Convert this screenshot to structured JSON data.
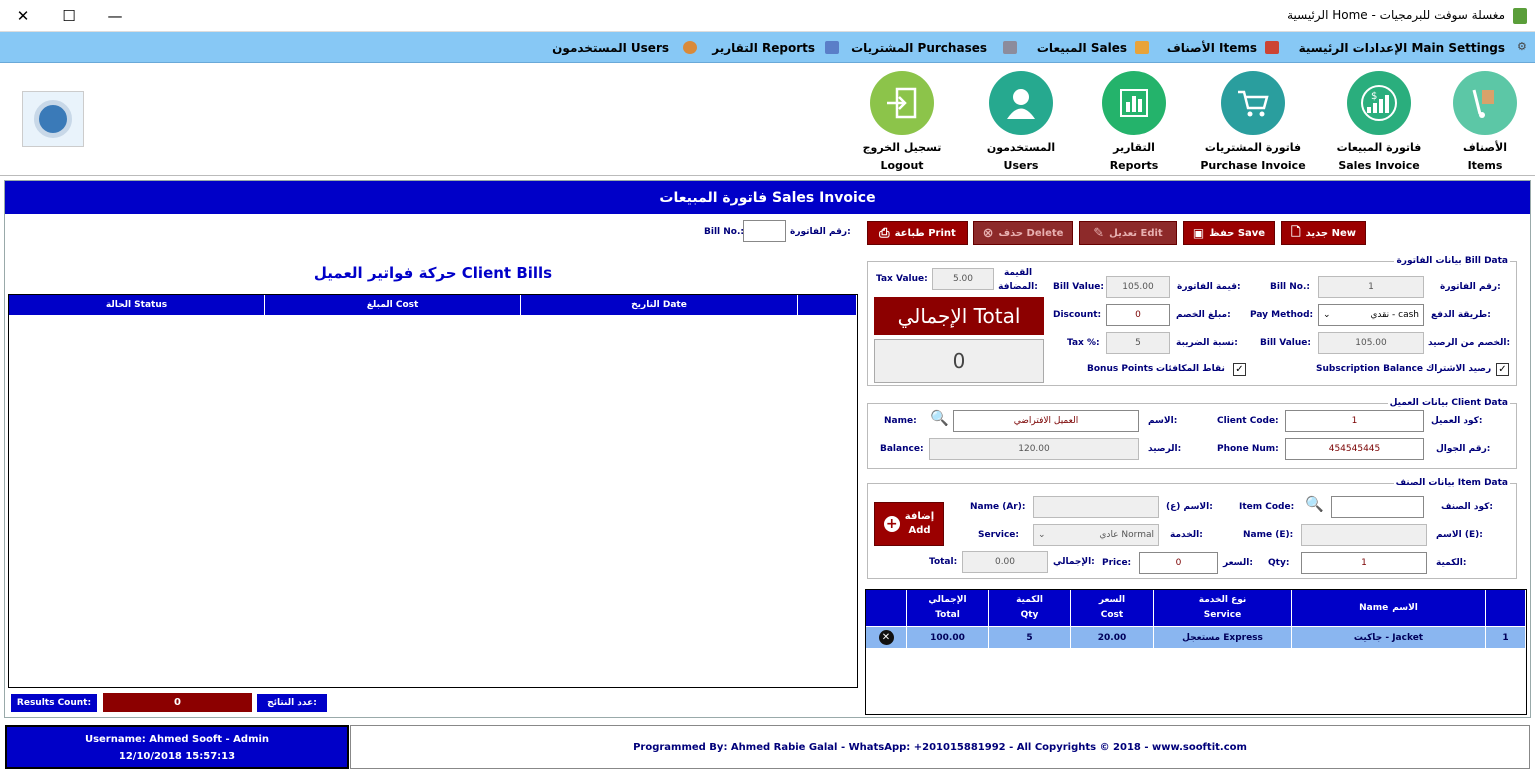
{
  "window": {
    "title": "الرئيسية Home - مغسلة سوفت للبرمجيات"
  },
  "menu": [
    {
      "label": "الإعدادات الرئيسية Main Settings",
      "icon": "gears-icon"
    },
    {
      "label": "الأصناف Items",
      "icon": "cart-icon"
    },
    {
      "label": "المبيعات Sales",
      "icon": "box-icon"
    },
    {
      "label": "المشتريات Purchases",
      "icon": "pen-icon"
    },
    {
      "label": "التقارير Reports",
      "icon": "books-icon"
    },
    {
      "label": "المستخدمون Users",
      "icon": "users-icon"
    }
  ],
  "toolbar": [
    {
      "ar": "الأصناف",
      "en": "Items",
      "icon": "hand-truck-icon",
      "color": "#5cc7a6"
    },
    {
      "ar": "فاتورة المبيعات",
      "en": "Sales Invoice",
      "icon": "growth-chart-icon",
      "color": "#2aae7d"
    },
    {
      "ar": "فاتورة المشتريات",
      "en": "Purchase Invoice",
      "icon": "shopping-cart-icon",
      "color": "#2a9e9e"
    },
    {
      "ar": "التقارير",
      "en": "Reports",
      "icon": "bar-chart-icon",
      "color": "#24b36b"
    },
    {
      "ar": "المستخدمون",
      "en": "Users",
      "icon": "user-icon",
      "color": "#26a98f"
    },
    {
      "ar": "تسجيل الخروج",
      "en": "Logout",
      "icon": "logout-icon",
      "color": "#8cc44a"
    }
  ],
  "header": {
    "title": "فاتورة المبيعات Sales Invoice"
  },
  "bill_search": {
    "label_ar": "رقم الفاتورة:",
    "label_en": "Bill No.:",
    "value": ""
  },
  "buttons": {
    "new": "جديد New",
    "save": "حفظ Save",
    "edit": "تعديل Edit",
    "delete": "حذف Delete",
    "print": "طباعة Print"
  },
  "bill_data": {
    "title": "بيانات الفاتورة Bill Data",
    "bill_no_ar": "رقم الفاتورة:",
    "bill_no_en": "Bill No.:",
    "bill_no": "1",
    "bill_value_ar": "قيمة الفاتورة:",
    "bill_value_en": "Bill Value:",
    "bill_value": "105.00",
    "tax_value_ar": "القيمة المضافة:",
    "tax_value_en": "Tax Value:",
    "tax_value": "5.00",
    "pay_method_ar": "طريقة الدفع:",
    "pay_method_en": "Pay Method:",
    "pay_method": "نقدي - cash",
    "discount_ar": "مبلغ الخصم:",
    "discount_en": "Discount:",
    "discount": "0",
    "deduct_ar": "الخصم من الرصيد:",
    "deduct_en": "Bill Value:",
    "deduct_value": "105.00",
    "tax_pct_ar": "نسبة الضريبة:",
    "tax_pct_en": "Tax %:",
    "tax_pct": "5",
    "subscription_ar": "رصيد الاشتراك",
    "subscription_en": "Subscription Balance",
    "bonus_ar": "نقاط المكافئات",
    "bonus_en": "Bonus Points",
    "total_label": "الإجمالي Total",
    "total_value": "0"
  },
  "client_data": {
    "title": "بيانات العميل Client Data",
    "code_ar": "كود العميل:",
    "code_en": "Client Code:",
    "code": "1",
    "name_ar": "الاسم:",
    "name_en": "Name:",
    "name": "العميل الافتراضي",
    "phone_ar": "رقم الجوال:",
    "phone_en": "Phone Num:",
    "phone": "454545445",
    "balance_ar": "الرصيد:",
    "balance_en": "Balance:",
    "balance": "120.00"
  },
  "item_data": {
    "title": "بيانات الصنف Item Data",
    "code_ar": "كود الصنف:",
    "code_en": "Item Code:",
    "code": "",
    "name_ar_ar": "الاسم (ع):",
    "name_ar_en": "Name (Ar):",
    "name_ar": "",
    "name_en_ar": "الاسم (E):",
    "name_en_en": "Name (E):",
    "name_en": "",
    "service_ar": "الخدمة:",
    "service_en": "Service:",
    "service": "عادي Normal",
    "qty_ar": "الكمية:",
    "qty_en": "Qty:",
    "qty": "1",
    "price_ar": "السعر:",
    "price_en": "Price:",
    "price": "0",
    "total_ar": "الإجمالي:",
    "total_en": "Total:",
    "total": "0.00",
    "add_ar": "إضافة",
    "add_en": "Add"
  },
  "item_grid": {
    "headers": [
      {
        "ar": "الاسم",
        "en": "Name"
      },
      {
        "ar": "نوع الخدمة",
        "en": "Service"
      },
      {
        "ar": "السعر",
        "en": "Cost"
      },
      {
        "ar": "الكمية",
        "en": "Qty"
      },
      {
        "ar": "الإجمالي",
        "en": "Total"
      }
    ],
    "rows": [
      {
        "no": "1",
        "name": "جاكيت - Jacket",
        "service": "مستعجل Express",
        "cost": "20.00",
        "qty": "5",
        "total": "100.00"
      }
    ]
  },
  "client_bills": {
    "title": "حركة فواتير العميل Client Bills",
    "headers": [
      "التاريخ Date",
      "المبلغ Cost",
      "الحالة Status"
    ],
    "results_en": "Results Count:",
    "results_value": "0",
    "results_ar": "عدد النتائج:"
  },
  "footer": {
    "user": "Username: Ahmed Sooft - Admin",
    "datetime": "12/10/2018 15:57:13",
    "credit": "Programmed By: Ahmed Rabie Galal - WhatsApp: +201015881992 - All Copyrights © 2018 - www.sooftit.com"
  }
}
